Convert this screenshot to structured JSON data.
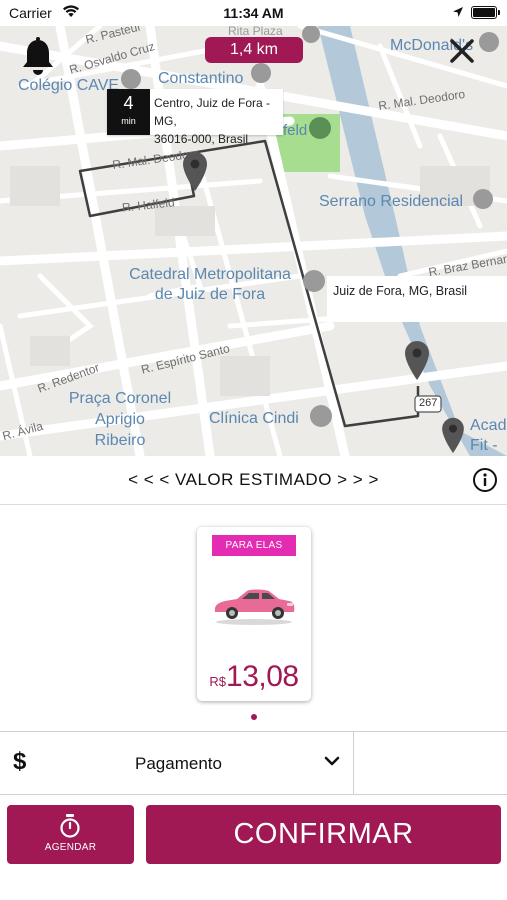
{
  "status_bar": {
    "carrier": "Carrier",
    "time": "11:34 AM"
  },
  "map": {
    "distance": "1,4 km",
    "origin": {
      "eta_value": "4",
      "eta_unit": "min",
      "address_line1": "Centro, Juiz de Fora - MG,",
      "address_line2": "36016-000, Brasil"
    },
    "destination": {
      "address": "Juiz de Fora, MG, Brasil"
    },
    "streets": {
      "pasteur": "R. Pasteur",
      "osvaldo_cruz": "R. Osvaldo Cruz",
      "mal_deodoro_left": "R. Mal. Deodoro",
      "mal_deodoro_right": "R. Mal. Deodoro",
      "halfeld": "R. Halfeld",
      "braz_bernardino": "R. Braz Bernard",
      "redentor": "R. Redentor",
      "espirito_santo": "R. Espírito Santo",
      "avila": "R. Ávila",
      "rita_plaza": "Rita Plaza",
      "route_267": "267",
      "feld": "feld"
    },
    "pois": {
      "colegio_caves": "Colégio CAVE",
      "constantino": "Constantino",
      "mcdonalds": "McDonald's",
      "serrano": "Serrano Residencial",
      "catedral_line1": "Catedral Metropolitana",
      "catedral_line2": "de Juiz de Fora",
      "praca_line1": "Praça Coronel",
      "praca_line2": "Aprigio",
      "praca_line3": "Ribeiro",
      "clinica": "Clínica Cindi",
      "academia_line1": "Acad",
      "academia_line2": "Fit - "
    }
  },
  "estimate": {
    "title": "< < < VALOR ESTIMADO > > >"
  },
  "car_option": {
    "tag": "PARA ELAS",
    "currency": "R$",
    "price": "13,08",
    "color": "#e86a96"
  },
  "payment": {
    "icon_symbol": "$",
    "label": "Pagamento"
  },
  "actions": {
    "schedule_label": "AGENDAR",
    "confirm_label": "CONFIRMAR"
  },
  "theme": {
    "primary": "#a11954",
    "tag": "#e42cb2",
    "route": "#3f3f3f"
  }
}
